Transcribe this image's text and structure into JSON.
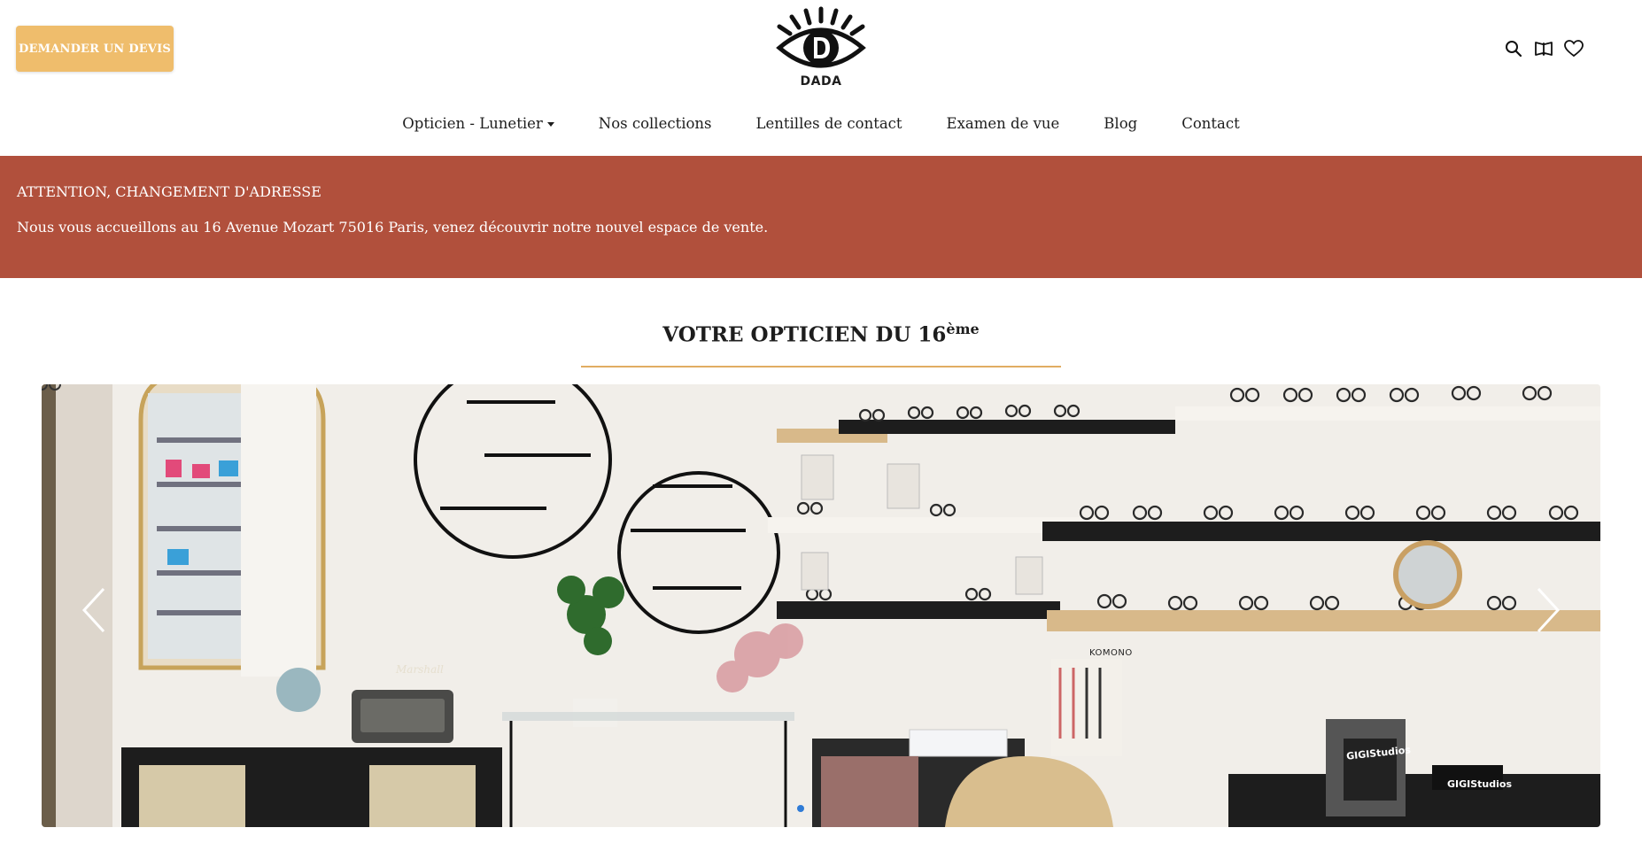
{
  "header": {
    "quote_button": "DEMANDER UN DEVIS",
    "logo_text": "DADA",
    "icons": [
      "search-icon",
      "book-icon",
      "heart-icon"
    ]
  },
  "nav": {
    "items": [
      {
        "label": "Opticien - Lunetier",
        "has_dropdown": true
      },
      {
        "label": "Nos collections"
      },
      {
        "label": "Lentilles de contact"
      },
      {
        "label": "Examen de vue"
      },
      {
        "label": "Blog"
      },
      {
        "label": "Contact"
      }
    ]
  },
  "banner": {
    "title": "ATTENTION, CHANGEMENT D'ADRESSE",
    "text": "Nous vous accueillons au 16 Avenue Mozart 75016 Paris, venez découvrir notre nouvel espace de vente."
  },
  "section": {
    "title": "VOTRE OPTICIEN DU 16",
    "title_sup": "ème"
  },
  "carousel": {
    "labels": {
      "komono": "KOMONO",
      "gigi_poster": "GIGIStudios",
      "gigi_box": "GIGIStudios",
      "speaker": "Marshall"
    },
    "active_slide": 1
  },
  "colors": {
    "accent": "#efbd6c",
    "banner": "#b1503c",
    "rule": "#e1ad62",
    "dot": "#2f7bd6"
  }
}
